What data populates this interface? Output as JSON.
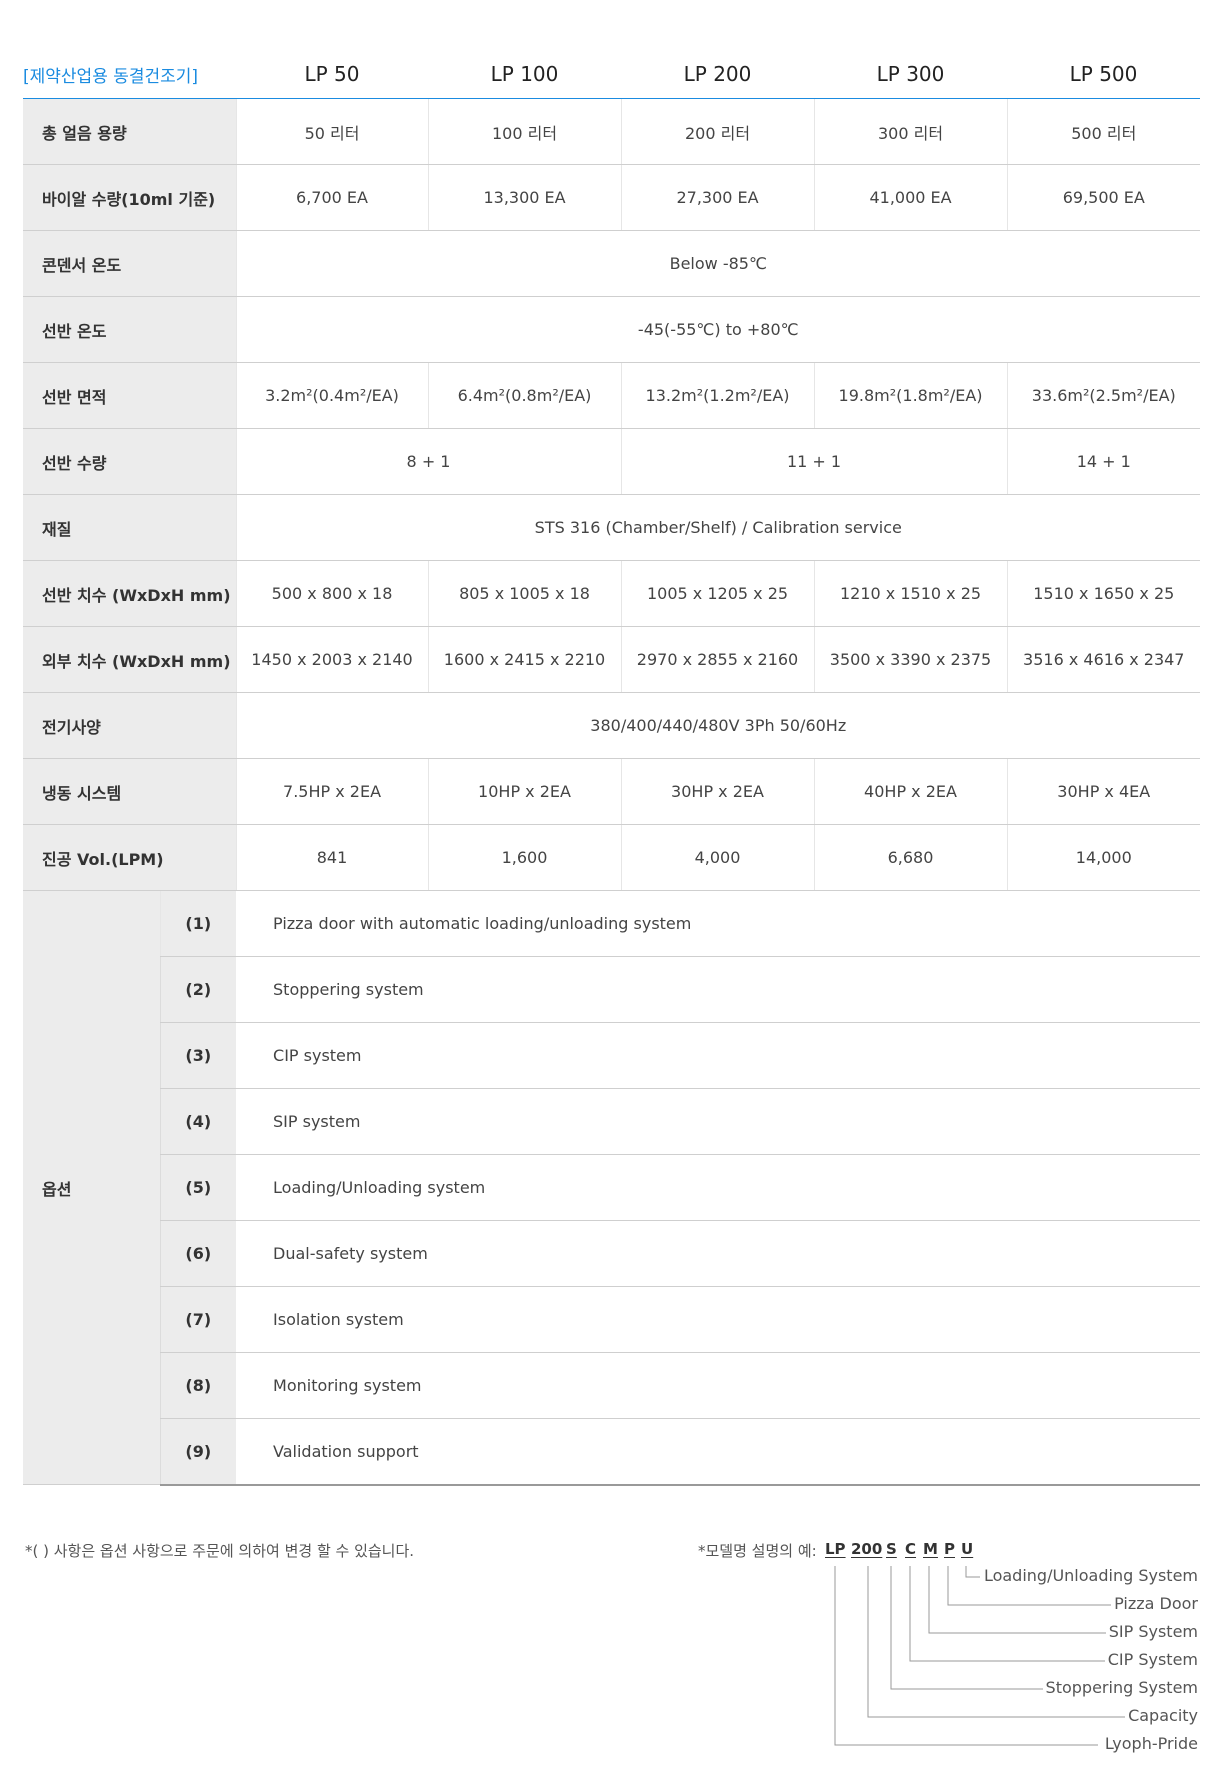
{
  "table": {
    "brand": "[제약산업용 동결건조기]",
    "models": [
      "LP 50",
      "LP 100",
      "LP 200",
      "LP 300",
      "LP 500"
    ],
    "ice_capacity": {
      "label": "총 얼음 용량",
      "values": [
        "50 리터",
        "100 리터",
        "200 리터",
        "300 리터",
        "500 리터"
      ]
    },
    "vial_qty": {
      "label": "바이알 수량(10ml 기준)",
      "values": [
        "6,700 EA",
        "13,300 EA",
        "27,300 EA",
        "41,000 EA",
        "69,500 EA"
      ]
    },
    "condenser_temp": {
      "label": "콘덴서 온도",
      "value": "Below -85℃"
    },
    "shelf_temp": {
      "label": "선반 온도",
      "value": "-45(-55℃) to +80℃"
    },
    "shelf_area": {
      "label": "선반 면적",
      "values": [
        "3.2m²(0.4m²/EA)",
        "6.4m²(0.8m²/EA)",
        "13.2m²(1.2m²/EA)",
        "19.8m²(1.8m²/EA)",
        "33.6m²(2.5m²/EA)"
      ]
    },
    "shelf_qty": {
      "label": "선반 수량",
      "values": [
        "8 + 1",
        "11 + 1",
        "14 + 1"
      ]
    },
    "material": {
      "label": "재질",
      "value": "STS 316 (Chamber/Shelf) / Calibration service"
    },
    "shelf_dim": {
      "label": "선반 치수 (WxDxH mm)",
      "values": [
        "500 x 800 x 18",
        "805 x 1005 x 18",
        "1005 x 1205 x 25",
        "1210 x 1510 x 25",
        "1510 x 1650 x 25"
      ]
    },
    "outer_dim": {
      "label": "외부 치수 (WxDxH mm)",
      "values": [
        "1450 x 2003 x 2140",
        "1600 x 2415 x 2210",
        "2970 x 2855 x 2160",
        "3500 x 3390 x 2375",
        "3516 x 4616 x 2347"
      ]
    },
    "electric": {
      "label": "전기사양",
      "value": "380/400/440/480V 3Ph 50/60Hz"
    },
    "refrigeration": {
      "label": "냉동 시스템",
      "values": [
        "7.5HP x 2EA",
        "10HP x 2EA",
        "30HP x 2EA",
        "40HP x 2EA",
        "30HP x 4EA"
      ]
    },
    "vacuum": {
      "label": "진공 Vol.(LPM)",
      "values": [
        "841",
        "1,600",
        "4,000",
        "6,680",
        "14,000"
      ]
    },
    "options": {
      "label": "옵션",
      "items": [
        {
          "num": "(1)",
          "text": "Pizza door with automatic loading/unloading system"
        },
        {
          "num": "(2)",
          "text": "Stoppering system"
        },
        {
          "num": "(3)",
          "text": "CIP system"
        },
        {
          "num": "(4)",
          "text": "SIP system"
        },
        {
          "num": "(5)",
          "text": "Loading/Unloading system"
        },
        {
          "num": "(6)",
          "text": "Dual-safety system"
        },
        {
          "num": "(7)",
          "text": "Isolation system"
        },
        {
          "num": "(8)",
          "text": "Monitoring system"
        },
        {
          "num": "(9)",
          "text": "Validation support"
        }
      ]
    }
  },
  "footnote": "*( ) 사항은 옵션 사항으로 주문에 의하여 변경 할 수 있습니다.",
  "model_example": {
    "prefix": "*모델명 설명의 예:",
    "codes": [
      "LP",
      "200",
      "S",
      "C",
      "M",
      "P",
      "U"
    ],
    "labels": [
      "Loading/Unloading System",
      "Pizza Door",
      "SIP System",
      "CIP System",
      "Stoppering System",
      "Capacity",
      "Lyoph-Pride"
    ]
  }
}
